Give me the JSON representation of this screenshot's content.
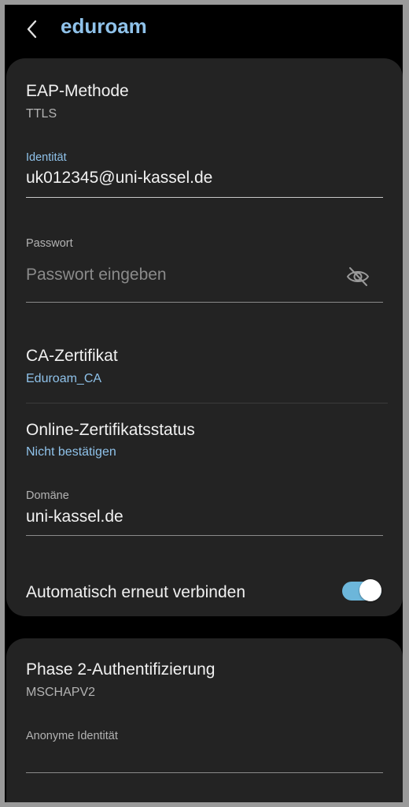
{
  "header": {
    "title": "eduroam",
    "back_icon": "chevron-left-icon"
  },
  "colors": {
    "accent": "#8fc2ea",
    "card_background": "#232323",
    "toggle_on": "#6cb6da"
  },
  "eap": {
    "label": "EAP-Methode",
    "value": "TTLS"
  },
  "identity": {
    "label": "Identität",
    "value": "uk012345@uni-kassel.de"
  },
  "password": {
    "label": "Passwort",
    "placeholder": "Passwort eingeben",
    "icon": "eye-off-icon"
  },
  "ca_cert": {
    "label": "CA-Zertifikat",
    "value": "Eduroam_CA"
  },
  "online_status": {
    "label": "Online-Zertifikatsstatus",
    "value": "Nicht bestätigen"
  },
  "domain": {
    "label": "Domäne",
    "value": "uni-kassel.de"
  },
  "auto_reconnect": {
    "label": "Automatisch erneut verbinden",
    "enabled": true
  },
  "phase2": {
    "label": "Phase 2-Authentifizierung",
    "value": "MSCHAPV2"
  },
  "anonymous_identity": {
    "label": "Anonyme Identität",
    "value": ""
  }
}
